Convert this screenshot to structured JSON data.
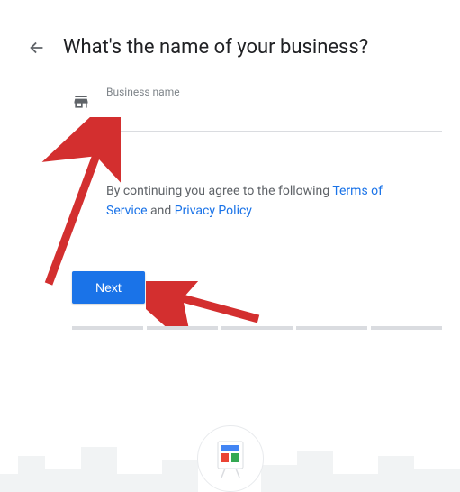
{
  "header": {
    "title": "What's the name of your business?"
  },
  "form": {
    "label": "Business name",
    "value": ""
  },
  "consent": {
    "prefix": "By continuing you agree to the following ",
    "terms": "Terms of Service",
    "and": " and ",
    "privacy": "Privacy Policy"
  },
  "actions": {
    "next": "Next"
  }
}
